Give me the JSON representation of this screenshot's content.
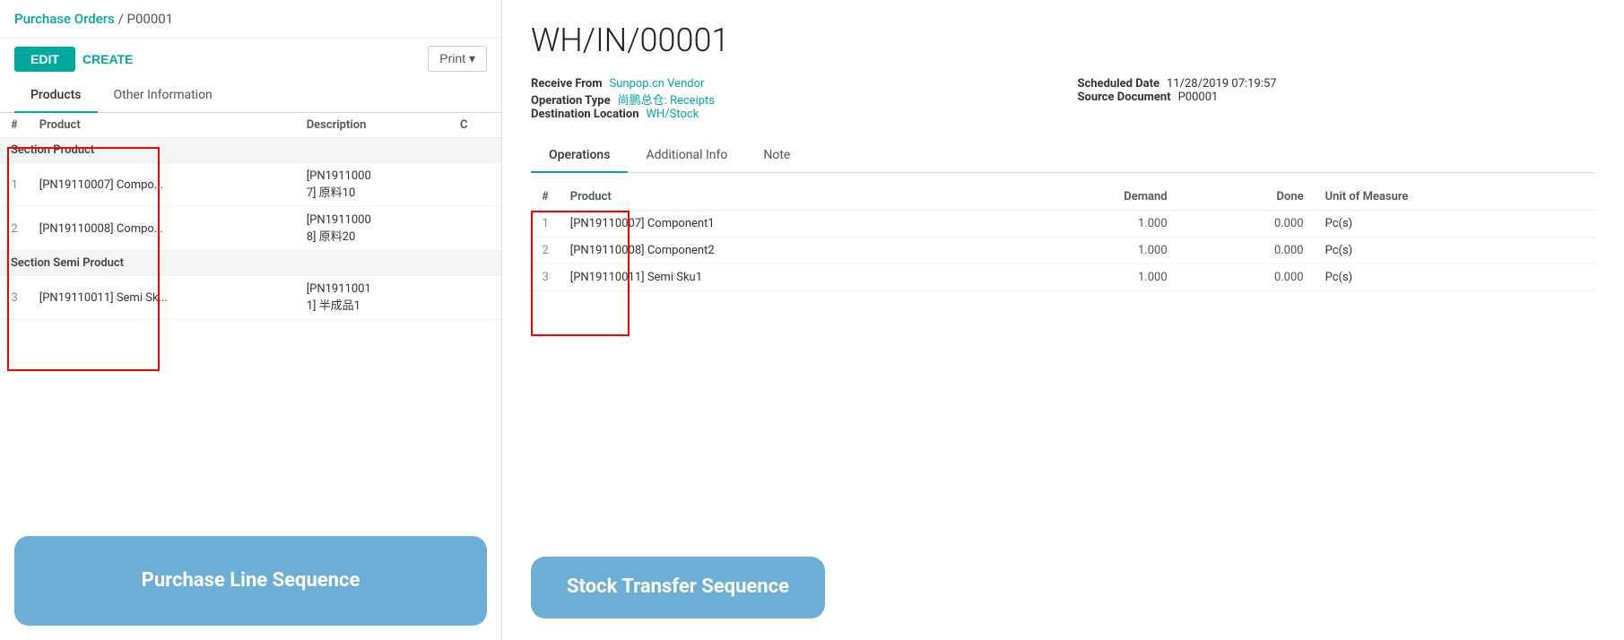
{
  "breadcrumb": {
    "parent": "Purchase Orders",
    "separator": "/",
    "current": "P00001"
  },
  "buttons": {
    "edit": "EDIT",
    "create": "CREATE",
    "print": "Print ▾"
  },
  "left_tabs": [
    {
      "id": "products",
      "label": "Products",
      "active": true
    },
    {
      "id": "other-info",
      "label": "Other Information",
      "active": false
    }
  ],
  "product_table": {
    "columns": [
      "#",
      "Product",
      "Description",
      "C"
    ],
    "rows": [
      {
        "type": "section",
        "label": "Section Product"
      },
      {
        "type": "data",
        "num": "1",
        "product": "[PN19110007] Compo...",
        "description": "[PN1911000 7] 原料10"
      },
      {
        "type": "data",
        "num": "2",
        "product": "[PN19110008] Compo...",
        "description": "[PN1911000 8] 原料20"
      },
      {
        "type": "section",
        "label": "Section Semi Product"
      },
      {
        "type": "data",
        "num": "3",
        "product": "[PN19110011] Semi Sk...",
        "description": "[PN1911001 1] 半成品1"
      }
    ]
  },
  "left_callout": {
    "label": "Purchase Line Sequence"
  },
  "wh_title": "WH/IN/00001",
  "info": {
    "receive_from_label": "Receive From",
    "receive_from_value": "Sunpop.cn Vendor",
    "operation_type_label": "Operation Type",
    "operation_type_value": "尚鹏总仓: Receipts",
    "destination_label": "Destination Location",
    "destination_value": "WH/Stock",
    "scheduled_date_label": "Scheduled Date",
    "scheduled_date_value": "11/28/2019 07:19:57",
    "source_doc_label": "Source Document",
    "source_doc_value": "P00001"
  },
  "right_tabs": [
    {
      "id": "operations",
      "label": "Operations",
      "active": true
    },
    {
      "id": "additional-info",
      "label": "Additional Info",
      "active": false
    },
    {
      "id": "note",
      "label": "Note",
      "active": false
    }
  ],
  "transfer_table": {
    "columns": [
      "#",
      "Product",
      "Demand",
      "Done",
      "Unit of Measure"
    ],
    "rows": [
      {
        "num": "1",
        "product": "[PN19110007] Component1",
        "demand": "1.000",
        "done": "0.000",
        "uom": "Pc(s)"
      },
      {
        "num": "2",
        "product": "[PN19110008] Component2",
        "demand": "1.000",
        "done": "0.000",
        "uom": "Pc(s)"
      },
      {
        "num": "3",
        "product": "[PN19110011] Semi Sku1",
        "demand": "1.000",
        "done": "0.000",
        "uom": "Pc(s)"
      }
    ]
  },
  "right_callout": {
    "label": "Stock Transfer Sequence"
  }
}
